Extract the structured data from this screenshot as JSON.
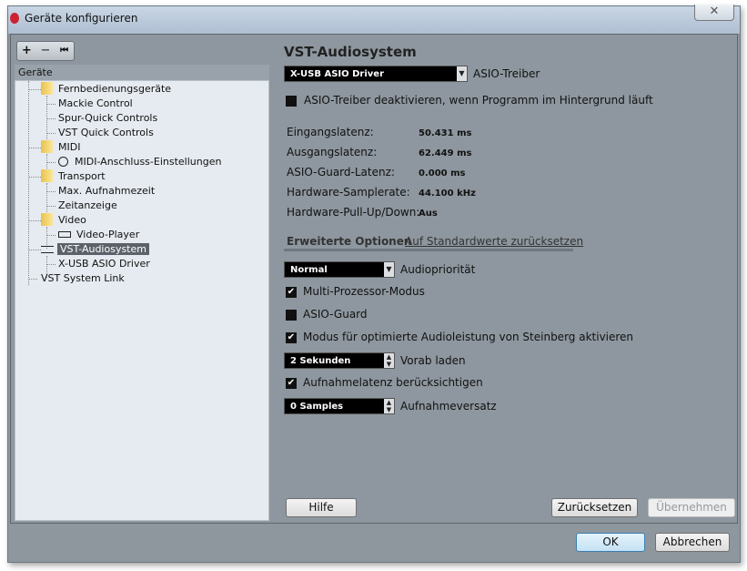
{
  "window": {
    "title": "Geräte konfigurieren",
    "close": "✕"
  },
  "toolbar": {
    "add": "+",
    "remove": "−",
    "reset": "⏮"
  },
  "tree": {
    "header": "Geräte",
    "items": [
      "Fernbedienungsgeräte",
      "Mackie Control",
      "Spur-Quick Controls",
      "VST Quick Controls",
      "MIDI",
      "MIDI-Anschluss-Einstellungen",
      "Transport",
      "Max. Aufnahmezeit",
      "Zeitanzeige",
      "Video",
      "Video-Player",
      "VST-Audiosystem",
      "X-USB ASIO Driver",
      "VST System Link"
    ]
  },
  "panel": {
    "title": "VST-Audiosystem",
    "driver": {
      "value": "X-USB ASIO Driver",
      "label": "ASIO-Treiber"
    },
    "deactivate": {
      "label": "ASIO-Treiber deaktivieren, wenn Programm im Hintergrund läuft",
      "checked": false
    },
    "info": [
      {
        "label": "Eingangslatenz:",
        "value": "50.431 ms"
      },
      {
        "label": "Ausgangslatenz:",
        "value": "62.449 ms"
      },
      {
        "label": "ASIO-Guard-Latenz:",
        "value": "0.000 ms"
      },
      {
        "label": "Hardware-Samplerate:",
        "value": "44.100 kHz"
      },
      {
        "label": "Hardware-Pull-Up/Down:",
        "value": "Aus"
      }
    ],
    "advanced_tab": "Erweiterte Optionen",
    "reset_defaults": "Auf Standardwerte zurücksetzen",
    "priority": {
      "value": "Normal",
      "label": "Audiopriorität"
    },
    "multi": {
      "label": "Multi-Prozessor-Modus",
      "checked": true
    },
    "guard": {
      "label": "ASIO-Guard",
      "checked": false
    },
    "steinberg": {
      "label": "Modus für optimierte Audioleistung von Steinberg aktivieren",
      "checked": true
    },
    "preload": {
      "value": "2 Sekunden",
      "label": "Vorab laden"
    },
    "latency": {
      "label": "Aufnahmelatenz berücksichtigen",
      "checked": true
    },
    "offset": {
      "value": "0 Samples",
      "label": "Aufnahmeversatz"
    },
    "help": "Hilfe",
    "reset": "Zurücksetzen",
    "apply": "Übernehmen"
  },
  "footer": {
    "ok": "OK",
    "cancel": "Abbrechen"
  },
  "check": "✔"
}
